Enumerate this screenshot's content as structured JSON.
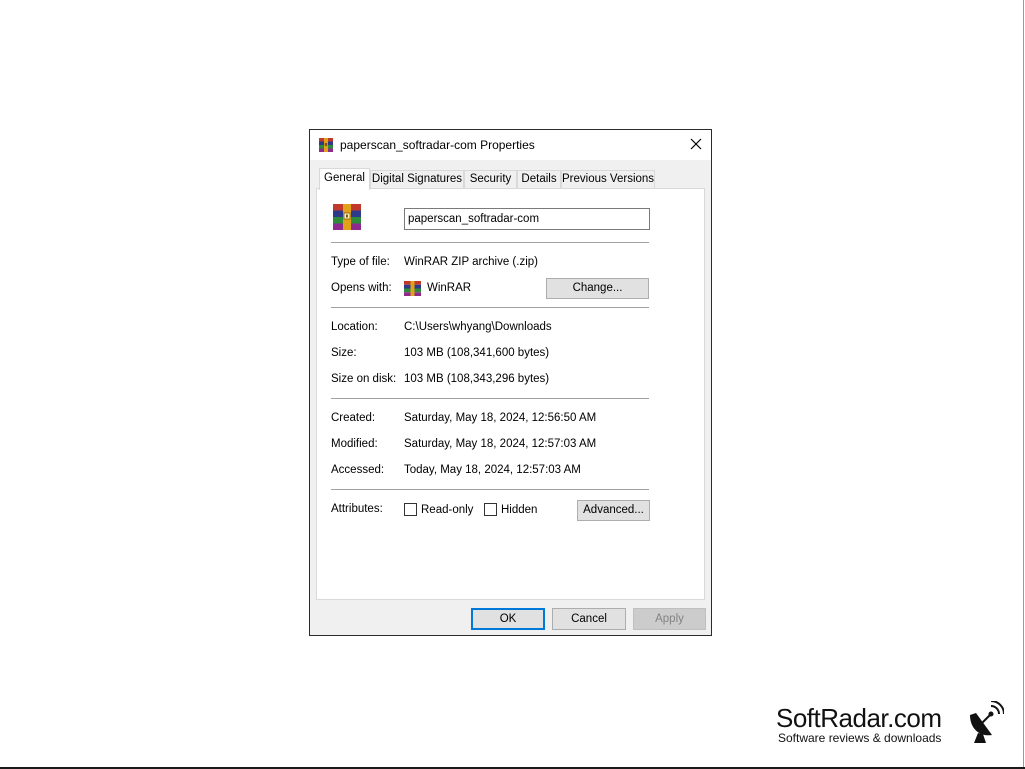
{
  "window": {
    "title": "paperscan_softradar-com Properties",
    "close_icon": "close-icon"
  },
  "tabs": [
    {
      "label": "General",
      "active": true
    },
    {
      "label": "Digital Signatures",
      "active": false
    },
    {
      "label": "Security",
      "active": false
    },
    {
      "label": "Details",
      "active": false
    },
    {
      "label": "Previous Versions",
      "active": false
    }
  ],
  "general": {
    "file_name": "paperscan_softradar-com",
    "type_label": "Type of file:",
    "type_value": "WinRAR ZIP archive (.zip)",
    "opens_label": "Opens with:",
    "opens_value": "WinRAR",
    "change_button": "Change...",
    "location_label": "Location:",
    "location_value": "C:\\Users\\whyang\\Downloads",
    "size_label": "Size:",
    "size_value": "103 MB (108,341,600 bytes)",
    "size_on_disk_label": "Size on disk:",
    "size_on_disk_value": "103 MB (108,343,296 bytes)",
    "created_label": "Created:",
    "created_value": "Saturday, May 18, 2024, 12:56:50 AM",
    "modified_label": "Modified:",
    "modified_value": "Saturday, May 18, 2024, 12:57:03 AM",
    "accessed_label": "Accessed:",
    "accessed_value": "Today, May 18, 2024, 12:57:03 AM",
    "attributes_label": "Attributes:",
    "readonly_label": "Read-only",
    "readonly_checked": false,
    "hidden_label": "Hidden",
    "hidden_checked": false,
    "advanced_button": "Advanced..."
  },
  "footer": {
    "ok": "OK",
    "cancel": "Cancel",
    "apply": "Apply"
  },
  "watermark": {
    "brand": "SoftRadar.com",
    "tagline": "Software reviews & downloads"
  },
  "colors": {
    "focus_blue": "#0078d7",
    "winrar_red": "#c0392b",
    "winrar_gold": "#e1a21a",
    "winrar_blue": "#2d3a8c",
    "winrar_green": "#2e8b3a"
  }
}
